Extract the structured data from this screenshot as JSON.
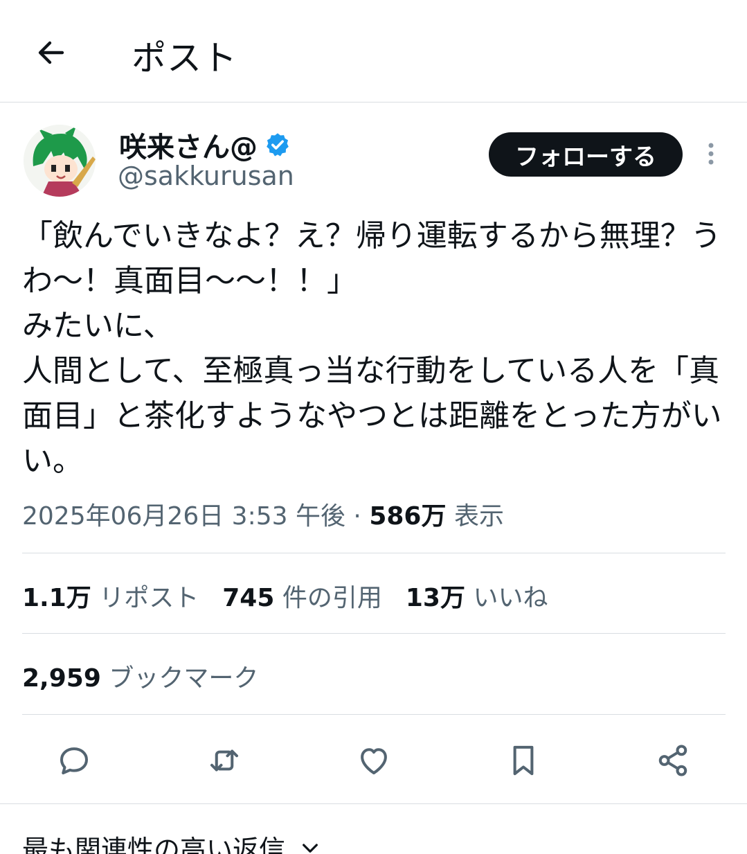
{
  "header": {
    "title": "ポスト",
    "back_icon": "arrow-left-icon"
  },
  "author": {
    "display_name": "咲来さん@",
    "handle": "@sakkurusan",
    "verified_icon": "verified-badge-icon",
    "verified_color": "#1d9bf0"
  },
  "follow_button": {
    "label": "フォローする"
  },
  "more_icon": "more-vertical-icon",
  "tweet": {
    "text": "「飲んでいきなよ？え？帰り運転するから無理？うわ～！真面目～～！！」\nみたいに、\n人間として、至極真っ当な行動をしている人を「真面目」と茶化すようなやつとは距離をとった方がいい。"
  },
  "meta": {
    "timestamp": "2025年06月26日 3:53 午後",
    "separator": "·",
    "views_count": "586万",
    "views_label": "表示"
  },
  "stats": {
    "reposts_count": "1.1万",
    "reposts_label": "リポスト",
    "quotes_count": "745",
    "quotes_label": "件の引用",
    "likes_count": "13万",
    "likes_label": "いいね",
    "bookmarks_count": "2,959",
    "bookmarks_label": "ブックマーク"
  },
  "actions": [
    "reply-icon",
    "repost-icon",
    "like-icon",
    "bookmark-icon",
    "share-icon"
  ],
  "replies": {
    "sort_label": "最も関連性の高い返信",
    "chevron_icon": "chevron-down-icon"
  },
  "colors": {
    "text": "#0f1419",
    "secondary": "#536471",
    "divider": "#d9dde1",
    "button_bg": "#0f1419"
  }
}
